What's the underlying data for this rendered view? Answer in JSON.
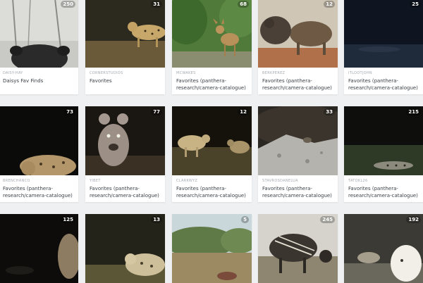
{
  "cards": [
    {
      "owner": "daisy-hay",
      "title": "Daisys Fav Finds",
      "count": "250"
    },
    {
      "owner": "cornerstudios",
      "title": "Favorites",
      "count": "31"
    },
    {
      "owner": "mcwakes",
      "title": "Favorites (panthera-research/camera-catalogue)",
      "count": "68"
    },
    {
      "owner": "berkperez",
      "title": "Favorites (panthera-research/camera-catalogue)",
      "count": "12"
    },
    {
      "owner": "itlootjohn",
      "title": "Favorites (panthera-research/camera-catalogue)",
      "count": "25"
    },
    {
      "owner": "brenchanco",
      "title": "Favorites (panthera-research/camera-catalogue)",
      "count": "73"
    },
    {
      "owner": "yibet",
      "title": "Favorites (panthera-research/camera-catalogue)",
      "count": "77"
    },
    {
      "owner": "clarkwyz",
      "title": "Favorites (panthera-research/camera-catalogue)",
      "count": "12"
    },
    {
      "owner": "stavrosdanelua",
      "title": "Favorites (panthera-research/camera-catalogue)",
      "count": "33"
    },
    {
      "owner": "tatokl26",
      "title": "Favorites (panthera-research/camera-catalogue)",
      "count": "215"
    },
    {
      "owner": "",
      "title": "",
      "count": "125"
    },
    {
      "owner": "",
      "title": "",
      "count": "13"
    },
    {
      "owner": "",
      "title": "",
      "count": "5"
    },
    {
      "owner": "",
      "title": "",
      "count": "245"
    },
    {
      "owner": "",
      "title": "",
      "count": "192"
    }
  ],
  "colors": {
    "background": "#eef0f2",
    "card": "#ffffff",
    "owner_text": "#a4aab0",
    "title_text": "#3b4248"
  }
}
